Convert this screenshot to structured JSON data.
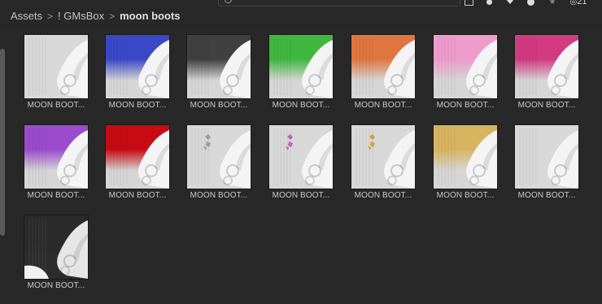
{
  "toolbar": {
    "visibility_count": "21"
  },
  "breadcrumb": {
    "items": [
      "Assets",
      "! GMsBox",
      "moon boots"
    ],
    "separator": ">"
  },
  "assets": [
    {
      "label": "MOON BOOT...",
      "color": "#d9d9d9",
      "variant": "white"
    },
    {
      "label": "MOON BOOT...",
      "color": "#3a48c8",
      "variant": "tint"
    },
    {
      "label": "MOON BOOT...",
      "color": "#404040",
      "variant": "tint"
    },
    {
      "label": "MOON BOOT...",
      "color": "#3fb83f",
      "variant": "tint"
    },
    {
      "label": "MOON BOOT...",
      "color": "#e0763f",
      "variant": "tint"
    },
    {
      "label": "MOON BOOT...",
      "color": "#ee9ccc",
      "variant": "tint"
    },
    {
      "label": "MOON BOOT...",
      "color": "#d23a82",
      "variant": "tint"
    },
    {
      "label": "MOON BOOT...",
      "color": "#9a4ccc",
      "variant": "tint"
    },
    {
      "label": "MOON BOOT...",
      "color": "#c80a12",
      "variant": "tint"
    },
    {
      "label": "MOON BOOT...",
      "color": "#d4d4d4",
      "variant": "sticker",
      "accent": "#9a9a9a"
    },
    {
      "label": "MOON BOOT...",
      "color": "#d4d4d4",
      "variant": "sticker",
      "accent": "#c060c0"
    },
    {
      "label": "MOON BOOT...",
      "color": "#d4d4d4",
      "variant": "sticker",
      "accent": "#d89a3a"
    },
    {
      "label": "MOON BOOT...",
      "color": "#d8b460",
      "variant": "tint"
    },
    {
      "label": "MOON BOOT...",
      "color": "#d9d9d9",
      "variant": "white"
    },
    {
      "label": "MOON BOOT...",
      "color": "#2a2a2a",
      "variant": "dark"
    }
  ]
}
